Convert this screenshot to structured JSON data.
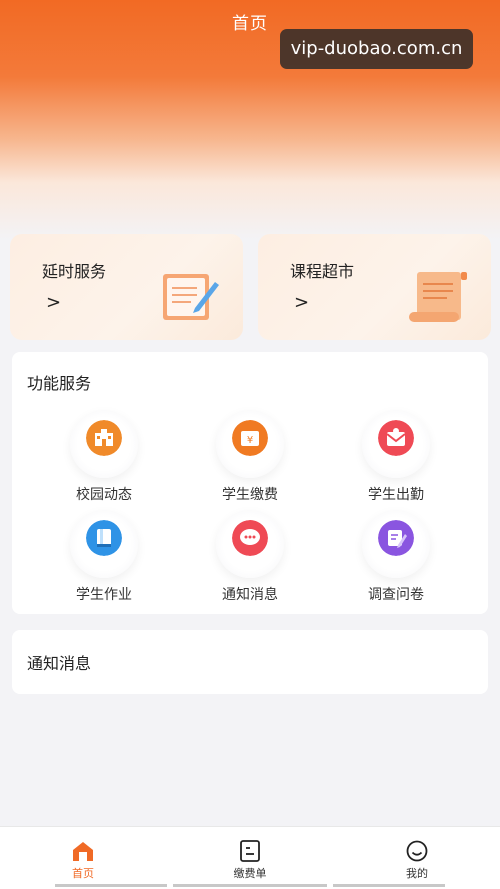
{
  "header": {
    "title": "首页"
  },
  "watermark": {
    "text": "vip-duobao.com.cn"
  },
  "service_cards": [
    {
      "title": "延时服务",
      "arrow": ">",
      "icon": "document-pencil-icon"
    },
    {
      "title": "课程超市",
      "arrow": ">",
      "icon": "scroll-doc-icon"
    }
  ],
  "functions": {
    "title": "功能服务",
    "items": [
      {
        "label": "校园动态",
        "icon": "school-building-icon",
        "color": "#f08a2a"
      },
      {
        "label": "学生缴费",
        "icon": "payment-bag-icon",
        "color": "#f07a22"
      },
      {
        "label": "学生出勤",
        "icon": "attendance-envelope-icon",
        "color": "#ef4a55"
      },
      {
        "label": "学生作业",
        "icon": "homework-book-icon",
        "color": "#2f93e6"
      },
      {
        "label": "通知消息",
        "icon": "message-bubble-icon",
        "color": "#ef4a55"
      },
      {
        "label": "调查问卷",
        "icon": "survey-edit-icon",
        "color": "#8a55e0"
      }
    ]
  },
  "notice": {
    "title": "通知消息"
  },
  "tabbar": {
    "active": "#f06a26",
    "items": [
      {
        "label": "首页",
        "icon": "home-icon"
      },
      {
        "label": "缴费单",
        "icon": "bill-icon"
      },
      {
        "label": "我的",
        "icon": "smile-icon"
      }
    ]
  }
}
